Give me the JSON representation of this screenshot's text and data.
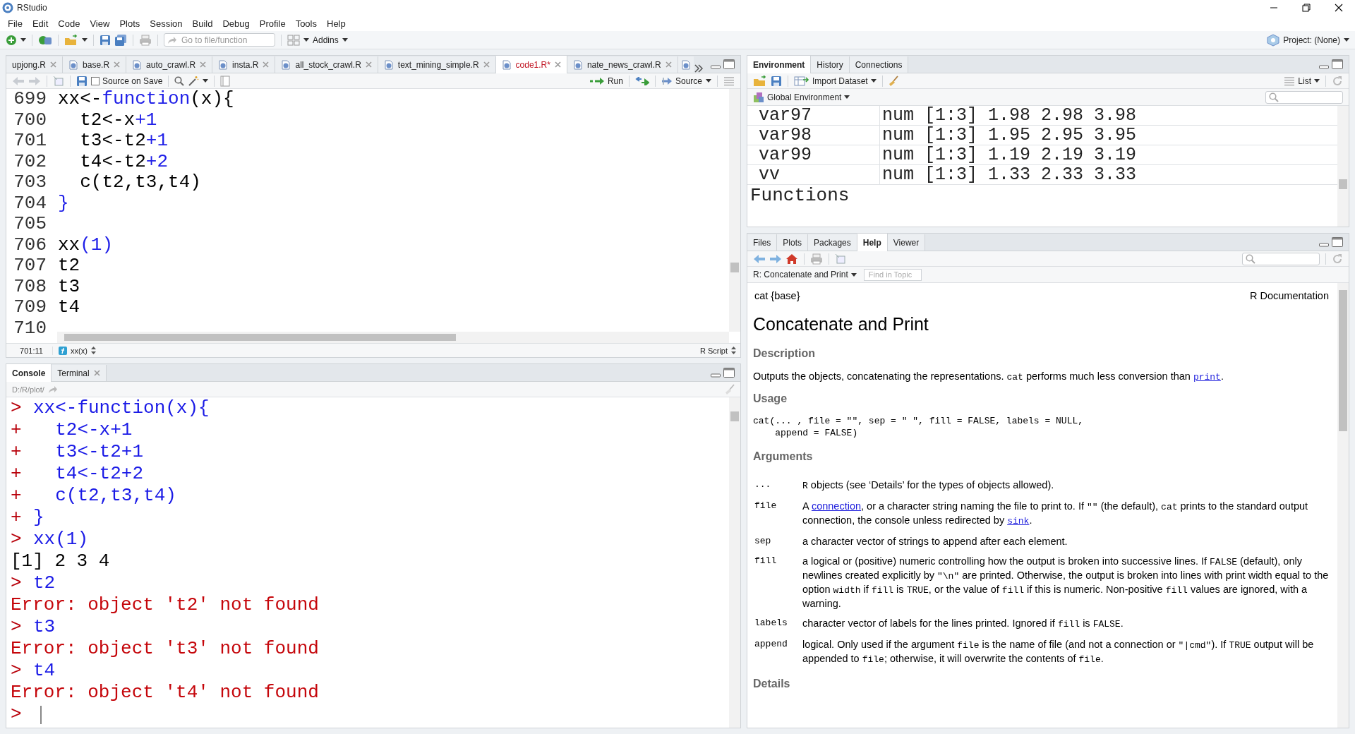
{
  "window": {
    "title": "RStudio"
  },
  "menu": [
    "File",
    "Edit",
    "Code",
    "View",
    "Plots",
    "Session",
    "Build",
    "Debug",
    "Profile",
    "Tools",
    "Help"
  ],
  "toolbar": {
    "goto_placeholder": "Go to file/function",
    "addins": "Addins",
    "project": "Project: (None)"
  },
  "editor": {
    "tabs": [
      {
        "label": "upjong.R",
        "icon": false,
        "selected": false,
        "modified": false
      },
      {
        "label": "base.R",
        "icon": true,
        "selected": false,
        "modified": false
      },
      {
        "label": "auto_crawl.R",
        "icon": true,
        "selected": false,
        "modified": false
      },
      {
        "label": "insta.R",
        "icon": true,
        "selected": false,
        "modified": false
      },
      {
        "label": "all_stock_crawl.R",
        "icon": true,
        "selected": false,
        "modified": false
      },
      {
        "label": "text_mining_simple.R",
        "icon": true,
        "selected": false,
        "modified": false
      },
      {
        "label": "code1.R*",
        "icon": true,
        "selected": true,
        "modified": true
      },
      {
        "label": "nate_news_crawl.R",
        "icon": true,
        "selected": false,
        "modified": false
      }
    ],
    "toolbar": {
      "source_on_save": {
        "label": "Source on Save",
        "checked": false
      },
      "run": "Run",
      "source": "Source"
    },
    "lines": [
      {
        "number": "699",
        "tokens": [
          {
            "t": "xx<-",
            "kind": "plain"
          },
          {
            "t": "function",
            "kind": "keyword"
          },
          {
            "t": "(x){",
            "kind": "plain"
          }
        ]
      },
      {
        "number": "700",
        "tokens": [
          {
            "t": "  t2<-x",
            "kind": "plain"
          },
          {
            "t": "+1",
            "kind": "number"
          }
        ]
      },
      {
        "number": "701",
        "tokens": [
          {
            "t": "  t3<-t2",
            "kind": "plain"
          },
          {
            "t": "+1",
            "kind": "number"
          }
        ]
      },
      {
        "number": "702",
        "tokens": [
          {
            "t": "  t4<-t2",
            "kind": "plain"
          },
          {
            "t": "+2",
            "kind": "number"
          }
        ]
      },
      {
        "number": "703",
        "tokens": [
          {
            "t": "  c(t2,t3,t4)",
            "kind": "plain"
          }
        ]
      },
      {
        "number": "704",
        "tokens": [
          {
            "t": "}",
            "kind": "number"
          }
        ]
      },
      {
        "number": "705"
      },
      {
        "number": "706",
        "tokens": [
          {
            "t": "xx",
            "kind": "plain"
          },
          {
            "t": "(1)",
            "kind": "number"
          }
        ]
      },
      {
        "number": "707",
        "tokens": [
          {
            "t": "t2",
            "kind": "plain"
          }
        ]
      },
      {
        "number": "708",
        "tokens": [
          {
            "t": "t3",
            "kind": "plain"
          }
        ]
      },
      {
        "number": "709",
        "tokens": [
          {
            "t": "t4",
            "kind": "plain"
          }
        ]
      },
      {
        "number": "710"
      }
    ],
    "status": {
      "position": "701:11",
      "scope": "xx(x)",
      "file_type": "R Script"
    }
  },
  "console": {
    "tabs": [
      {
        "label": "Console",
        "selected": true,
        "closable": false
      },
      {
        "label": "Terminal",
        "selected": false,
        "closable": true
      }
    ],
    "path": "D:/R/plot/",
    "lines": [
      {
        "kind": "input",
        "prompt": ">",
        "text": "xx<-function(x){"
      },
      {
        "kind": "input",
        "prompt": "+",
        "text": "  t2<-x+1"
      },
      {
        "kind": "input",
        "prompt": "+",
        "text": "  t3<-t2+1"
      },
      {
        "kind": "input",
        "prompt": "+",
        "text": "  t4<-t2+2"
      },
      {
        "kind": "input",
        "prompt": "+",
        "text": "  c(t2,t3,t4)"
      },
      {
        "kind": "input",
        "prompt": "+",
        "text": "}"
      },
      {
        "kind": "input",
        "prompt": ">",
        "text": "xx(1)"
      },
      {
        "kind": "output",
        "text": "[1] 2 3 4"
      },
      {
        "kind": "input",
        "prompt": ">",
        "text": "t2"
      },
      {
        "kind": "error",
        "text": "Error: object 't2' not found"
      },
      {
        "kind": "input",
        "prompt": ">",
        "text": "t3"
      },
      {
        "kind": "error",
        "text": "Error: object 't3' not found"
      },
      {
        "kind": "input",
        "prompt": ">",
        "text": "t4"
      },
      {
        "kind": "error",
        "text": "Error: object 't4' not found"
      },
      {
        "kind": "prompt",
        "prompt": ">"
      }
    ]
  },
  "environment": {
    "tabs": [
      {
        "label": "Environment",
        "selected": true
      },
      {
        "label": "History",
        "selected": false
      },
      {
        "label": "Connections",
        "selected": false
      }
    ],
    "toolbar": {
      "import": "Import Dataset",
      "view": "List"
    },
    "scope": "Global Environment",
    "rows": [
      {
        "name": "var97",
        "value": "num [1:3] 1.98 2.98 3.98"
      },
      {
        "name": "var98",
        "value": "num [1:3] 1.95 2.95 3.95"
      },
      {
        "name": "var99",
        "value": "num [1:3] 1.19 2.19 3.19"
      },
      {
        "name": "vv",
        "value": "num [1:3] 1.33 2.33 3.33"
      }
    ],
    "section": "Functions"
  },
  "help_pane": {
    "tabs": [
      {
        "label": "Files",
        "selected": false
      },
      {
        "label": "Plots",
        "selected": false
      },
      {
        "label": "Packages",
        "selected": false
      },
      {
        "label": "Help",
        "selected": true
      },
      {
        "label": "Viewer",
        "selected": false
      }
    ],
    "topic": "R: Concatenate and Print",
    "find_placeholder": "Find in Topic",
    "page": {
      "package": "cat {base}",
      "doc_label": "R Documentation",
      "title": "Concatenate and Print",
      "blocks": [
        {
          "kind": "heading",
          "text": "Description"
        },
        {
          "kind": "para",
          "parts": [
            {
              "t": "Outputs the objects, concatenating the representations. ",
              "kind": "text"
            },
            {
              "t": "cat",
              "kind": "code"
            },
            {
              "t": " performs much less conversion than ",
              "kind": "text"
            },
            {
              "t": "print",
              "kind": "code-link"
            },
            {
              "t": ".",
              "kind": "text"
            }
          ]
        },
        {
          "kind": "heading",
          "text": "Usage"
        },
        {
          "kind": "code",
          "text": "cat(... , file = \"\", sep = \" \", fill = FALSE, labels = NULL,\n    append = FALSE)"
        },
        {
          "kind": "heading",
          "text": "Arguments"
        },
        {
          "kind": "args",
          "items": [
            {
              "name": "...",
              "parts": [
                {
                  "t": "R",
                  "kind": "code"
                },
                {
                  "t": " objects (see ‘Details’ for the types of objects allowed).",
                  "kind": "text"
                }
              ]
            },
            {
              "name": "file",
              "parts": [
                {
                  "t": "A ",
                  "kind": "text"
                },
                {
                  "t": "connection",
                  "kind": "link"
                },
                {
                  "t": ", or a character string naming the file to print to. If ",
                  "kind": "text"
                },
                {
                  "t": "\"\"",
                  "kind": "code"
                },
                {
                  "t": " (the default), ",
                  "kind": "text"
                },
                {
                  "t": "cat",
                  "kind": "code"
                },
                {
                  "t": " prints to the standard output connection, the console unless redirected by ",
                  "kind": "text"
                },
                {
                  "t": "sink",
                  "kind": "code-link"
                },
                {
                  "t": ".",
                  "kind": "text"
                }
              ]
            },
            {
              "name": "sep",
              "parts": [
                {
                  "t": "a character vector of strings to append after each element.",
                  "kind": "text"
                }
              ]
            },
            {
              "name": "fill",
              "parts": [
                {
                  "t": "a logical or (positive) numeric controlling how the output is broken into successive lines. If ",
                  "kind": "text"
                },
                {
                  "t": "FALSE",
                  "kind": "code"
                },
                {
                  "t": " (default), only newlines created explicitly by ",
                  "kind": "text"
                },
                {
                  "t": "\"\\n\"",
                  "kind": "code"
                },
                {
                  "t": " are printed. Otherwise, the output is broken into lines with print width equal to the option ",
                  "kind": "text"
                },
                {
                  "t": "width",
                  "kind": "code"
                },
                {
                  "t": " if ",
                  "kind": "text"
                },
                {
                  "t": "fill",
                  "kind": "code"
                },
                {
                  "t": " is ",
                  "kind": "text"
                },
                {
                  "t": "TRUE",
                  "kind": "code"
                },
                {
                  "t": ", or the value of ",
                  "kind": "text"
                },
                {
                  "t": "fill",
                  "kind": "code"
                },
                {
                  "t": " if this is numeric. Non-positive ",
                  "kind": "text"
                },
                {
                  "t": "fill",
                  "kind": "code"
                },
                {
                  "t": " values are ignored, with a warning.",
                  "kind": "text"
                }
              ]
            },
            {
              "name": "labels",
              "parts": [
                {
                  "t": "character vector of labels for the lines printed. Ignored if ",
                  "kind": "text"
                },
                {
                  "t": "fill",
                  "kind": "code"
                },
                {
                  "t": " is ",
                  "kind": "text"
                },
                {
                  "t": "FALSE",
                  "kind": "code"
                },
                {
                  "t": ".",
                  "kind": "text"
                }
              ]
            },
            {
              "name": "append",
              "parts": [
                {
                  "t": "logical. Only used if the argument ",
                  "kind": "text"
                },
                {
                  "t": "file",
                  "kind": "code"
                },
                {
                  "t": " is the name of file (and not a connection or ",
                  "kind": "text"
                },
                {
                  "t": "\"|cmd\"",
                  "kind": "code"
                },
                {
                  "t": "). If ",
                  "kind": "text"
                },
                {
                  "t": "TRUE",
                  "kind": "code"
                },
                {
                  "t": " output will be appended to ",
                  "kind": "text"
                },
                {
                  "t": "file",
                  "kind": "code"
                },
                {
                  "t": "; otherwise, it will overwrite the contents of ",
                  "kind": "text"
                },
                {
                  "t": "file",
                  "kind": "code"
                },
                {
                  "t": ".",
                  "kind": "text"
                }
              ]
            }
          ]
        },
        {
          "kind": "heading",
          "text": "Details"
        }
      ]
    }
  }
}
